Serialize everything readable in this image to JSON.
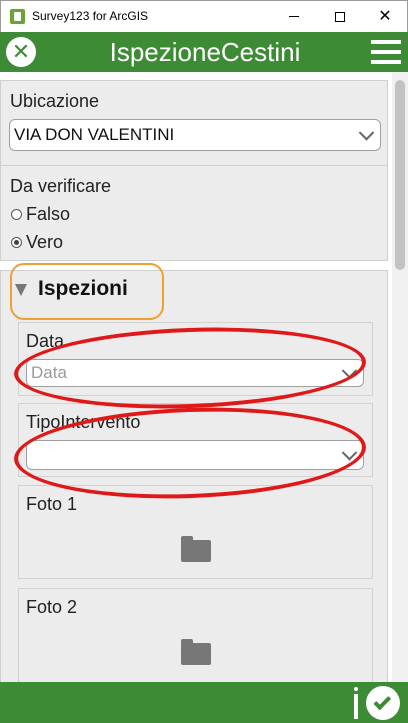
{
  "window": {
    "title": "Survey123 for ArcGIS",
    "minimize_icon": "minimize-icon",
    "maximize_icon": "maximize-icon",
    "close_glyph": "✕"
  },
  "header": {
    "title": "IspezioneCestini",
    "close_icon": "close-icon",
    "menu_icon": "hamburger-menu-icon",
    "color": "#3d8b35"
  },
  "form": {
    "ubicazione": {
      "label": "Ubicazione",
      "value": "VIA DON VALENTINI"
    },
    "da_verificare": {
      "label": "Da verificare",
      "options": [
        {
          "label": "Falso",
          "selected": false
        },
        {
          "label": "Vero",
          "selected": true
        }
      ]
    },
    "group": {
      "title": "Ispezioni",
      "highlight_color": "#f0a030",
      "data": {
        "label": "Data",
        "placeholder": "Data"
      },
      "tipo_intervento": {
        "label": "TipoIntervento",
        "value": ""
      },
      "foto1": {
        "label": "Foto 1",
        "icon": "folder-icon"
      },
      "foto2": {
        "label": "Foto 2",
        "icon": "folder-icon"
      }
    }
  },
  "footer": {
    "info_icon": "info-icon",
    "submit_icon": "checkmark-icon"
  },
  "annotation_color": "#e01818"
}
